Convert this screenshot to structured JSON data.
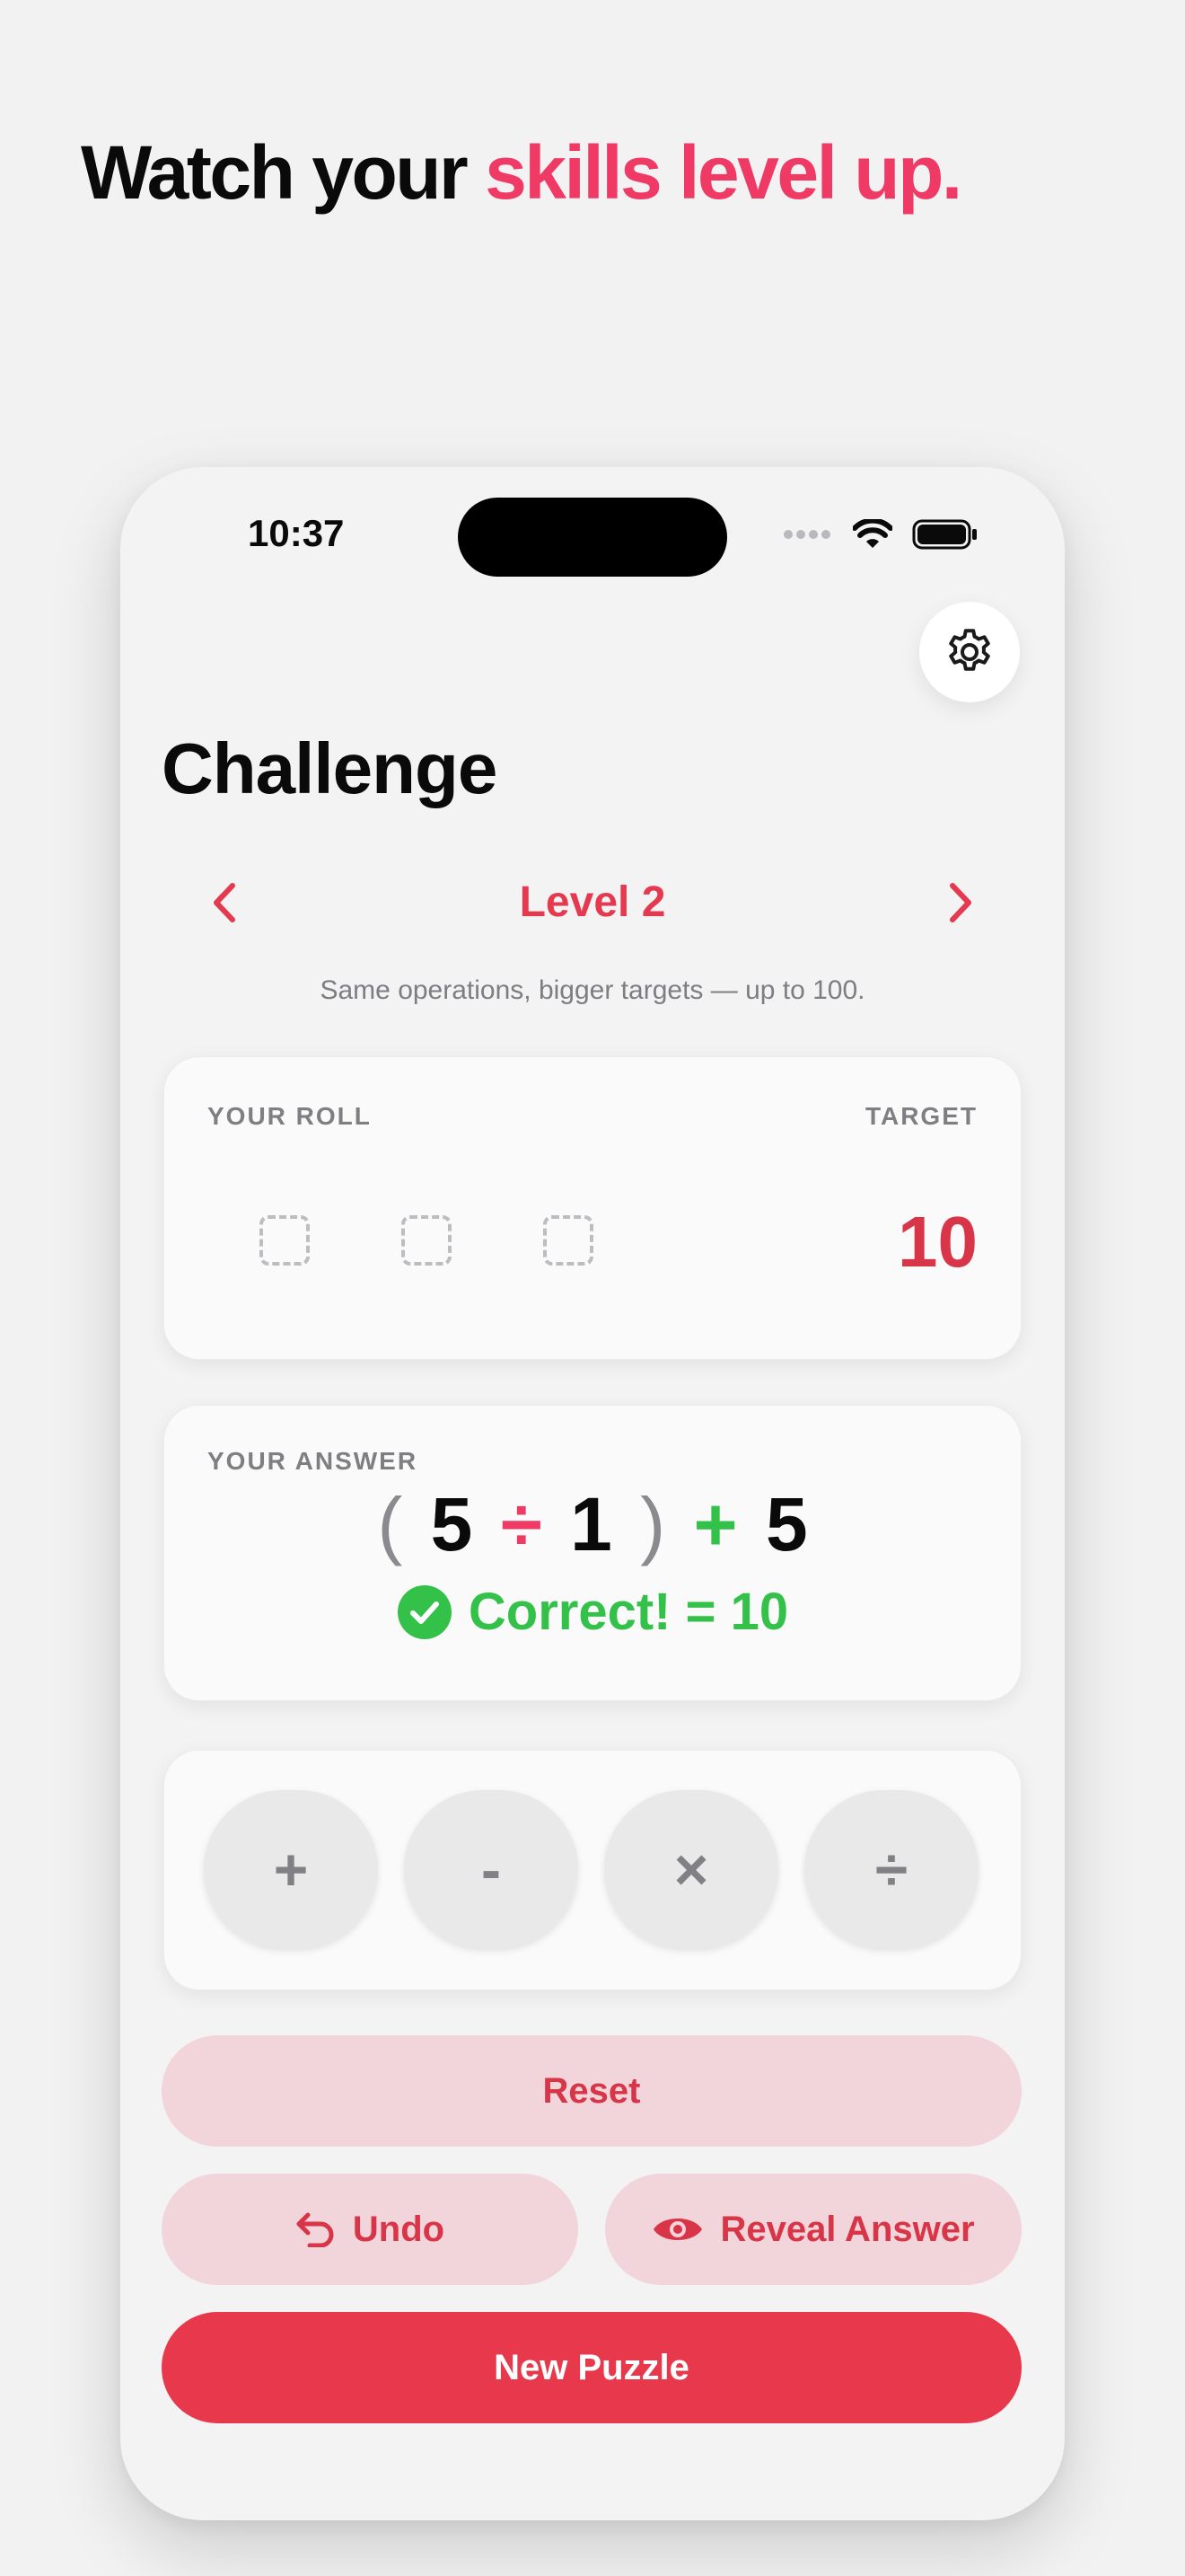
{
  "headline": {
    "prefix": "Watch your ",
    "accent": "skills level up.",
    "accent_color": "#f03a66"
  },
  "status_bar": {
    "time": "10:37",
    "icons": [
      "signal-dots-icon",
      "wifi-icon",
      "battery-icon"
    ]
  },
  "header": {
    "title": "Challenge",
    "settings_icon": "gear-icon"
  },
  "level": {
    "label": "Level 2",
    "description": "Same operations, bigger targets — up to 100.",
    "prev_icon": "chevron-left-icon",
    "next_icon": "chevron-right-icon"
  },
  "roll": {
    "label": "YOUR ROLL",
    "target_label": "TARGET",
    "target_value": "10",
    "dice_count": 3
  },
  "answer": {
    "label": "YOUR ANSWER",
    "tokens": [
      "(",
      "5",
      "÷",
      "1",
      ")",
      "+",
      "5"
    ],
    "status_text": "Correct! = 10",
    "status_icon": "check-circle-icon"
  },
  "operators": [
    {
      "symbol": "+",
      "name": "plus"
    },
    {
      "symbol": "-",
      "name": "minus"
    },
    {
      "symbol": "×",
      "name": "multiply"
    },
    {
      "symbol": "÷",
      "name": "divide"
    }
  ],
  "actions": {
    "reset": "Reset",
    "undo": "Undo",
    "reveal": "Reveal Answer",
    "new_puzzle": "New Puzzle"
  },
  "colors": {
    "accent": "#e8384c",
    "success": "#34c14a",
    "pill_bg": "#f2d5da"
  }
}
